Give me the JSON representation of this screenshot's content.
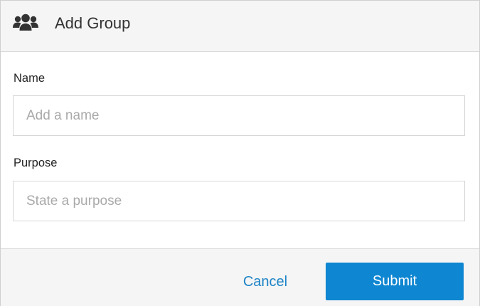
{
  "dialog": {
    "title": "Add Group",
    "header_icon": "users-icon"
  },
  "form": {
    "name": {
      "label": "Name",
      "placeholder": "Add a name",
      "value": ""
    },
    "purpose": {
      "label": "Purpose",
      "placeholder": "State a purpose",
      "value": ""
    }
  },
  "actions": {
    "cancel_label": "Cancel",
    "submit_label": "Submit"
  },
  "colors": {
    "accent": "#0f86d1",
    "link": "#1f84c6",
    "header_bg": "#f5f5f5",
    "icon": "#333333"
  }
}
